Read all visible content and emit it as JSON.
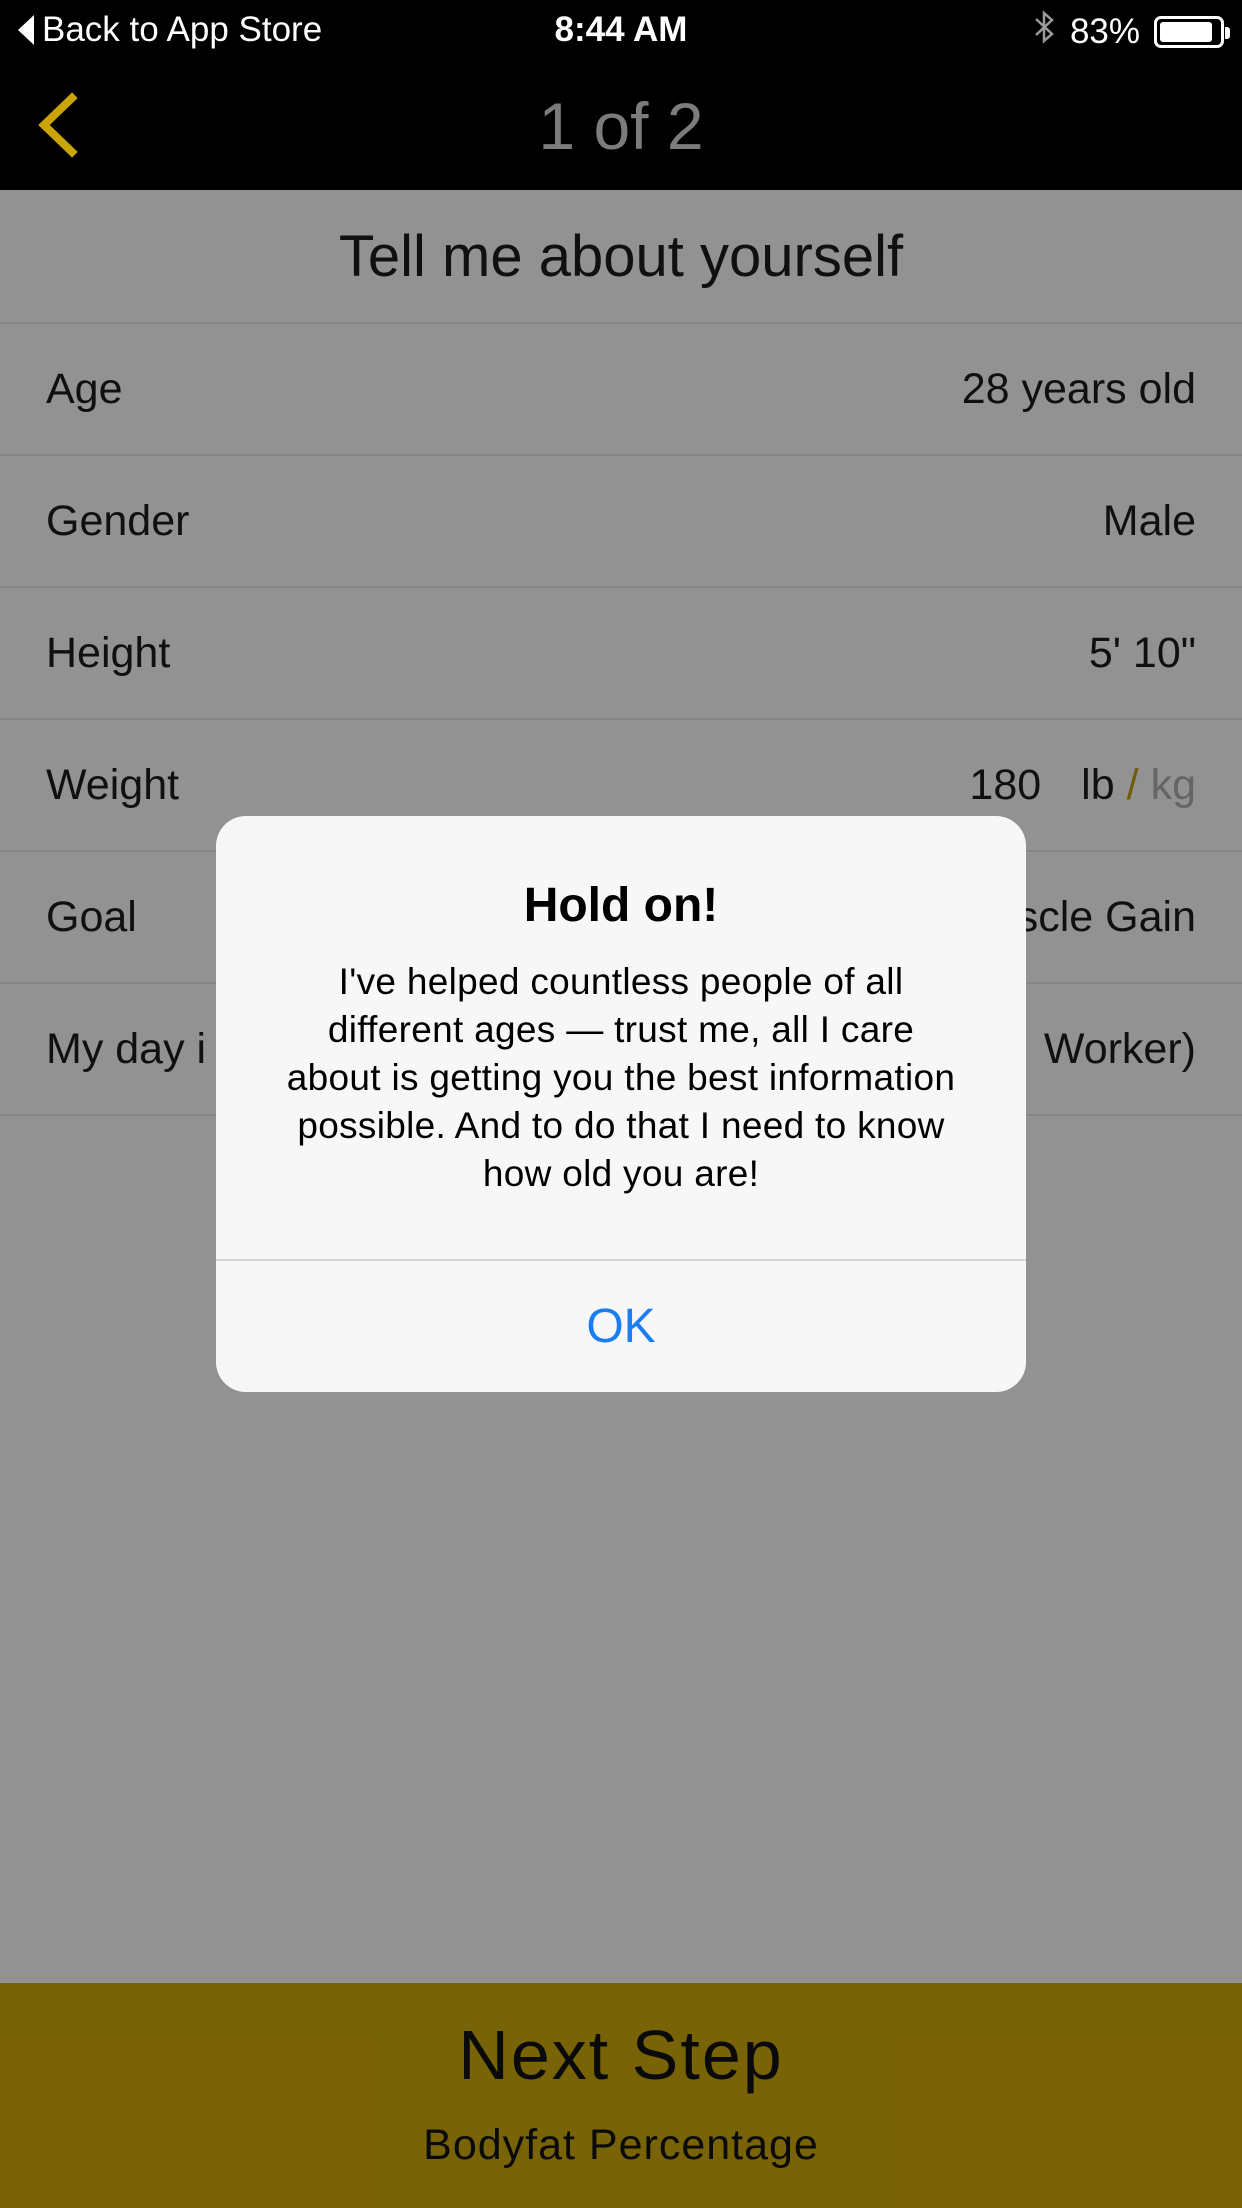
{
  "status_bar": {
    "back_label": "Back to App Store",
    "time": "8:44 AM",
    "battery": "83%",
    "bluetooth_icon": "bluetooth-icon"
  },
  "nav": {
    "title": "1 of 2",
    "back_icon": "chevron-left-icon",
    "accent_color": "#c9a50a"
  },
  "form": {
    "title": "Tell me about yourself",
    "rows": [
      {
        "label": "Age",
        "value": "28 years old"
      },
      {
        "label": "Gender",
        "value": "Male"
      },
      {
        "label": "Height",
        "value": "5' 10\""
      },
      {
        "label": "Weight",
        "value": "180",
        "unit_lb": "lb",
        "separator": "/",
        "unit_kg": "kg"
      },
      {
        "label": "Goal",
        "value": "scle Gain"
      },
      {
        "label": "My day i",
        "value": "Worker)"
      }
    ]
  },
  "next_button": {
    "title": "Next Step",
    "subtitle": "Bodyfat Percentage"
  },
  "alert": {
    "title": "Hold on!",
    "message": "I've helped countless people of all different ages — trust me, all I care about is getting you the best information possible. And to do that I need to know how old you are!",
    "ok_label": "OK"
  }
}
